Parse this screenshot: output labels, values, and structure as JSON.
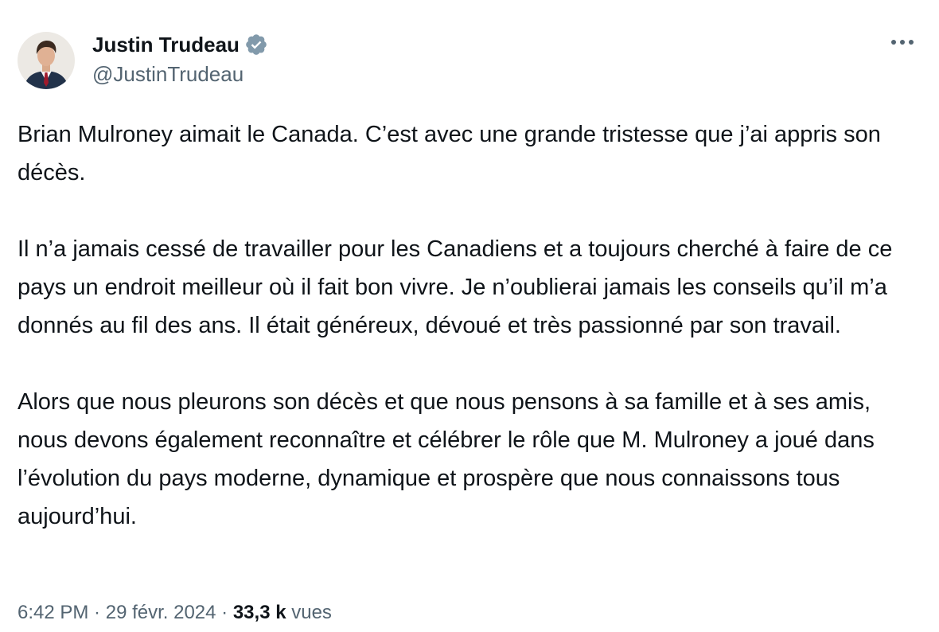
{
  "author": {
    "display_name": "Justin Trudeau",
    "handle": "@JustinTrudeau",
    "verified": true,
    "verified_color": "#829aab"
  },
  "icons": {
    "avatar": "profile-photo",
    "verified": "verified-badge-icon",
    "more": "more-horizontal-icon"
  },
  "tweet": {
    "paragraphs": [
      "Brian Mulroney aimait le Canada. C’est avec une grande tristesse que j’ai appris son décès.",
      "Il n’a jamais cessé de travailler pour les Canadiens et a toujours cherché à faire de ce pays un endroit meilleur où il fait bon vivre. Je n’oublierai jamais les conseils qu’il m’a donnés au fil des ans. Il était généreux, dévoué et très passionné par son travail.",
      "Alors que nous pleurons son décès et que nous pensons à sa famille et à ses amis, nous devons également reconnaître et célébrer le rôle que M. Mulroney a joué dans l’évolution du pays moderne, dynamique et prospère que nous connaissons tous aujourd’hui."
    ]
  },
  "meta": {
    "time": "6:42 PM",
    "separator": " · ",
    "date": "29 févr. 2024",
    "views_count": "33,3 k",
    "views_label": "vues"
  },
  "colors": {
    "text_primary": "#0f1419",
    "text_secondary": "#536471"
  }
}
